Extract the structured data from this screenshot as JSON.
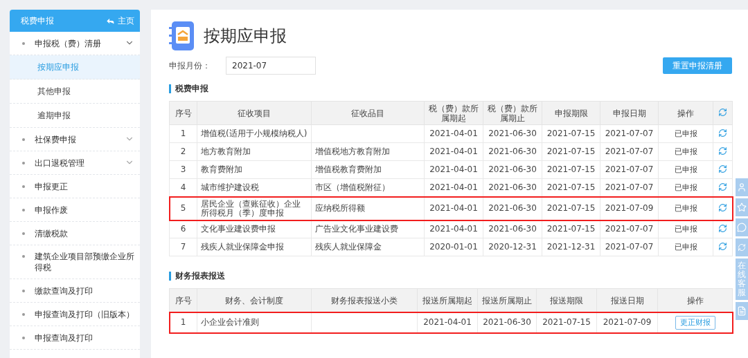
{
  "sidebar": {
    "title": "税费申报",
    "home_link": "主页",
    "items": [
      {
        "label": "申报税（费）清册",
        "expanded": true,
        "has_children": true,
        "children": [
          {
            "label": "按期应申报",
            "selected": true
          },
          {
            "label": "其他申报",
            "selected": false
          },
          {
            "label": "逾期申报",
            "selected": false
          }
        ]
      },
      {
        "label": "社保费申报",
        "expanded": false,
        "has_children": true
      },
      {
        "label": "出口退税管理",
        "expanded": false,
        "has_children": true
      },
      {
        "label": "申报更正",
        "has_children": false
      },
      {
        "label": "申报作废",
        "has_children": false
      },
      {
        "label": "清缴税款",
        "has_children": false
      },
      {
        "label": "建筑企业项目部预缴企业所得税",
        "has_children": false
      },
      {
        "label": "缴款查询及打印",
        "has_children": false
      },
      {
        "label": "申报查询及打印（旧版本）",
        "has_children": false
      },
      {
        "label": "申报查询及打印",
        "has_children": false
      }
    ]
  },
  "page_title": "按期应申报",
  "month_field": {
    "label": "申报月份：",
    "value": "2021-07"
  },
  "reset_button": "重置申报清册",
  "tax_section": {
    "title": "税费申报",
    "columns": [
      "序号",
      "征收项目",
      "征收品目",
      "税（费）款所属期起",
      "税（费）款所属期止",
      "申报期限",
      "申报日期",
      "操作"
    ],
    "rows": [
      {
        "cells": [
          "1",
          "增值税(适用于小规模纳税人)",
          "",
          "2021-04-01",
          "2021-06-30",
          "2021-07-15",
          "2021-07-07",
          "已申报"
        ],
        "highlighted": false
      },
      {
        "cells": [
          "2",
          "地方教育附加",
          "增值税地方教育附加",
          "2021-04-01",
          "2021-06-30",
          "2021-07-15",
          "2021-07-07",
          "已申报"
        ],
        "highlighted": false
      },
      {
        "cells": [
          "3",
          "教育费附加",
          "增值税教育费附加",
          "2021-04-01",
          "2021-06-30",
          "2021-07-15",
          "2021-07-07",
          "已申报"
        ],
        "highlighted": false
      },
      {
        "cells": [
          "4",
          "城市维护建设税",
          "市区（增值税附征）",
          "2021-04-01",
          "2021-06-30",
          "2021-07-15",
          "2021-07-07",
          "已申报"
        ],
        "highlighted": false
      },
      {
        "cells": [
          "5",
          "居民企业（查账征收）企业所得税月（季）度申报",
          "应纳税所得额",
          "2021-04-01",
          "2021-06-30",
          "2021-07-15",
          "2021-07-09",
          "已申报"
        ],
        "highlighted": true
      },
      {
        "cells": [
          "6",
          "文化事业建设费申报",
          "广告业文化事业建设费",
          "2021-04-01",
          "2021-06-30",
          "2021-07-15",
          "2021-07-07",
          "已申报"
        ],
        "highlighted": false
      },
      {
        "cells": [
          "7",
          "残疾人就业保障金申报",
          "残疾人就业保障金",
          "2020-01-01",
          "2020-12-31",
          "2021-12-31",
          "2021-07-07",
          "已申报"
        ],
        "highlighted": false
      }
    ]
  },
  "finance_section": {
    "title": "财务报表报送",
    "columns": [
      "序号",
      "财务、会计制度",
      "财务报表报送小类",
      "报送所属期起",
      "报送所属期止",
      "报送期限",
      "报送日期",
      "操作"
    ],
    "rows": [
      {
        "cells": [
          "1",
          "小企业会计准则",
          "",
          "2021-04-01",
          "2021-06-30",
          "2021-07-15",
          "2021-07-09"
        ],
        "action": "更正财报",
        "highlighted": true
      }
    ]
  },
  "side_service": {
    "label": "在线客服"
  }
}
